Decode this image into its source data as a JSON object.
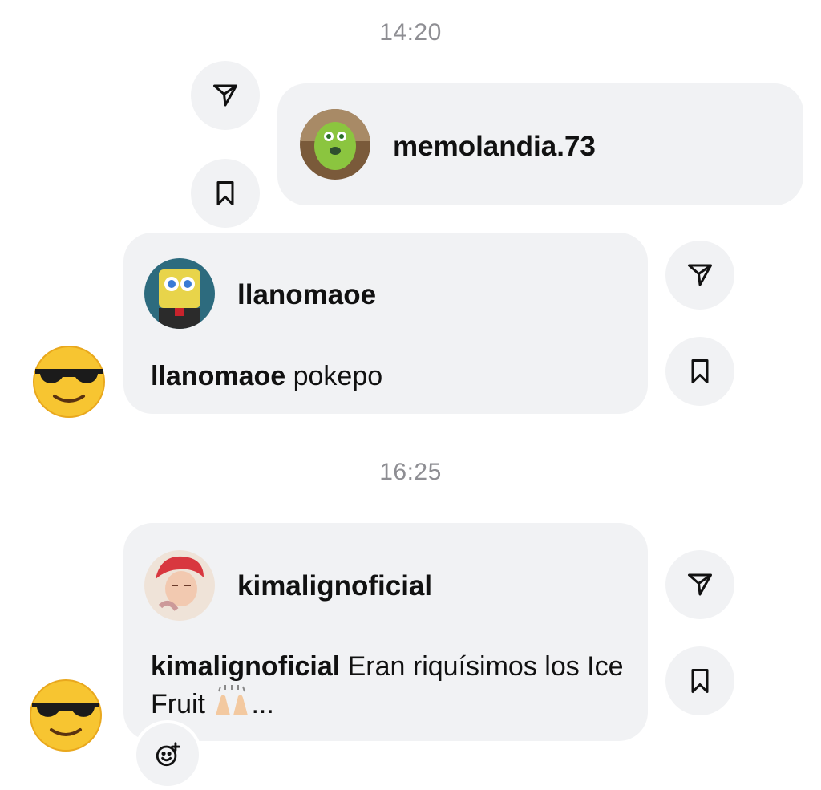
{
  "timestamps": [
    "14:20",
    "16:25"
  ],
  "messages": [
    {
      "username": "memolandia.73",
      "caption_user": "",
      "caption_text": "",
      "avatar": "green-monster-avatar"
    },
    {
      "username": "llanomaoe",
      "caption_user": "llanomaoe",
      "caption_text": " pokepo",
      "avatar": "sponge-character-avatar",
      "reaction_emoji": "smiling-face-with-sunglasses"
    },
    {
      "username": "kimalignoficial",
      "caption_user": "kimalignoficial",
      "caption_text": " Eran riquísimos los Ice Fruit",
      "caption_suffix": "...",
      "caption_emoji": "raising-hands",
      "avatar": "red-hair-person-avatar",
      "reaction_emoji": "smiling-face-with-sunglasses"
    }
  ],
  "icons": {
    "share": "paper-plane-icon",
    "save": "bookmark-icon",
    "add_reaction": "add-reaction-icon"
  },
  "colors": {
    "bubble": "#f1f2f4",
    "timestamp": "#8e8e93",
    "text": "#111111"
  }
}
